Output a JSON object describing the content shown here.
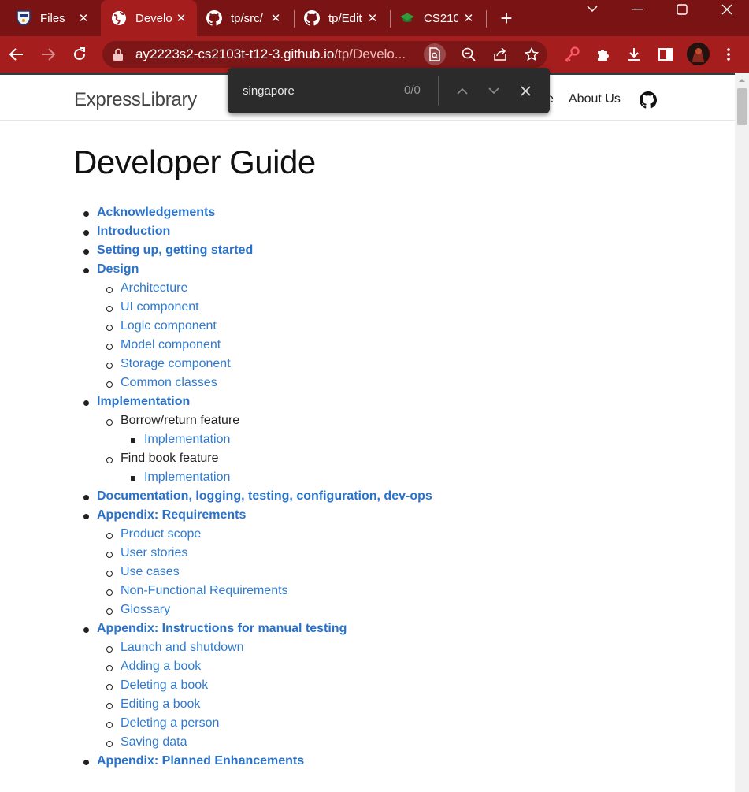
{
  "tabs": [
    {
      "title": "Files",
      "icon": "university-shield-icon"
    },
    {
      "title": "Develo",
      "icon": "globe-icon",
      "active": true
    },
    {
      "title": "tp/src/",
      "icon": "github-icon"
    },
    {
      "title": "tp/Edit",
      "icon": "github-icon"
    },
    {
      "title": "CS210",
      "icon": "graduation-cap-icon"
    }
  ],
  "omnibox": {
    "host": "ay2223s2-cs2103t-t12-3.github.io",
    "path": "/tp/Develo..."
  },
  "find": {
    "query": "singapore",
    "count": "0/0"
  },
  "site": {
    "brand": "ExpressLibrary",
    "nav_partial": "e",
    "nav_about": "About Us"
  },
  "page_title": "Developer Guide",
  "toc": [
    {
      "label": "Acknowledgements",
      "level": 1,
      "link": true
    },
    {
      "label": "Introduction",
      "level": 1,
      "link": true
    },
    {
      "label": "Setting up, getting started",
      "level": 1,
      "link": true
    },
    {
      "label": "Design",
      "level": 1,
      "link": true
    },
    {
      "label": "Architecture",
      "level": 2,
      "link": true
    },
    {
      "label": "UI component",
      "level": 2,
      "link": true
    },
    {
      "label": "Logic component",
      "level": 2,
      "link": true
    },
    {
      "label": "Model component",
      "level": 2,
      "link": true
    },
    {
      "label": "Storage component",
      "level": 2,
      "link": true
    },
    {
      "label": "Common classes",
      "level": 2,
      "link": true
    },
    {
      "label": "Implementation",
      "level": 1,
      "link": true
    },
    {
      "label": "Borrow/return feature",
      "level": 2,
      "link": false
    },
    {
      "label": "Implementation",
      "level": 3,
      "link": true
    },
    {
      "label": "Find book feature",
      "level": 2,
      "link": false
    },
    {
      "label": "Implementation",
      "level": 3,
      "link": true
    },
    {
      "label": "Documentation, logging, testing, configuration, dev-ops",
      "level": 1,
      "link": true
    },
    {
      "label": "Appendix: Requirements",
      "level": 1,
      "link": true
    },
    {
      "label": "Product scope",
      "level": 2,
      "link": true
    },
    {
      "label": "User stories",
      "level": 2,
      "link": true
    },
    {
      "label": "Use cases",
      "level": 2,
      "link": true
    },
    {
      "label": "Non-Functional Requirements",
      "level": 2,
      "link": true
    },
    {
      "label": "Glossary",
      "level": 2,
      "link": true
    },
    {
      "label": "Appendix: Instructions for manual testing",
      "level": 1,
      "link": true
    },
    {
      "label": "Launch and shutdown",
      "level": 2,
      "link": true
    },
    {
      "label": "Adding a book",
      "level": 2,
      "link": true
    },
    {
      "label": "Deleting a book",
      "level": 2,
      "link": true
    },
    {
      "label": "Editing a book",
      "level": 2,
      "link": true
    },
    {
      "label": "Deleting a person",
      "level": 2,
      "link": true
    },
    {
      "label": "Saving data",
      "level": 2,
      "link": true
    },
    {
      "label": "Appendix: Planned Enhancements",
      "level": 1,
      "link": true
    }
  ],
  "colors": {
    "tabstrip": "#7a1414",
    "toolbar": "#a51d1d",
    "link": "#2f7acf",
    "findbar": "#2b2b2b"
  }
}
